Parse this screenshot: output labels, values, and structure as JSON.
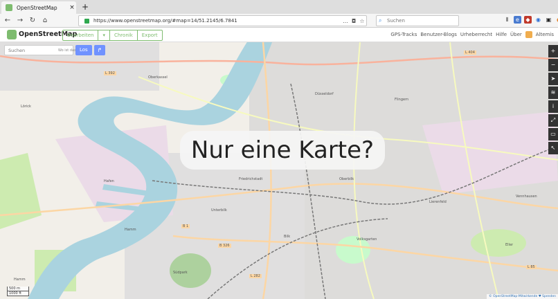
{
  "browser": {
    "tab_title": "OpenStreetMap",
    "tab_close": "×",
    "new_tab": "+",
    "url": "https://www.openstreetmap.org/#map=14/51.2145/6.7841",
    "search_placeholder": "Suchen"
  },
  "osm": {
    "brand": "OpenStreetMap",
    "edit_buttons": [
      "Bearbeiten",
      "▾",
      "Chronik",
      "Export"
    ],
    "nav_links": [
      "GPS-Tracks",
      "Benutzer-Blogs",
      "Urheberrecht",
      "Hilfe",
      "Über"
    ],
    "user": "Altemis"
  },
  "map": {
    "search_placeholder": "Suchen",
    "where_am_i": "Wo ist das?",
    "go_label": "Los",
    "banner": "Nur eine Karte?",
    "scale_m": "500 m",
    "scale_ft": "1000 ft",
    "attribution": "© OpenStreetMap-Mitwirkende ♥ Spenden",
    "labels": [
      "Oberkassel",
      "Hafen",
      "Düsseldorf",
      "Unterbilk",
      "Bilk",
      "Flingern",
      "Lierenfeld",
      "Vennhausen",
      "Hamm",
      "Eller",
      "Oberbilk",
      "Friedrichstadt",
      "Volksgarten",
      "Südpark",
      "Lörick",
      "Hamm"
    ],
    "road_labels": [
      "L 392",
      "B 1",
      "L 282",
      "L 404",
      "B 326",
      "L 85"
    ],
    "controls": [
      "+",
      "−",
      "➤",
      "≋",
      "i",
      "⤢",
      "▭",
      "↖"
    ]
  },
  "colors": {
    "accent": "#7ebc6f",
    "button": "#7092ff",
    "river": "#aad3df",
    "land": "#f2efe9"
  }
}
